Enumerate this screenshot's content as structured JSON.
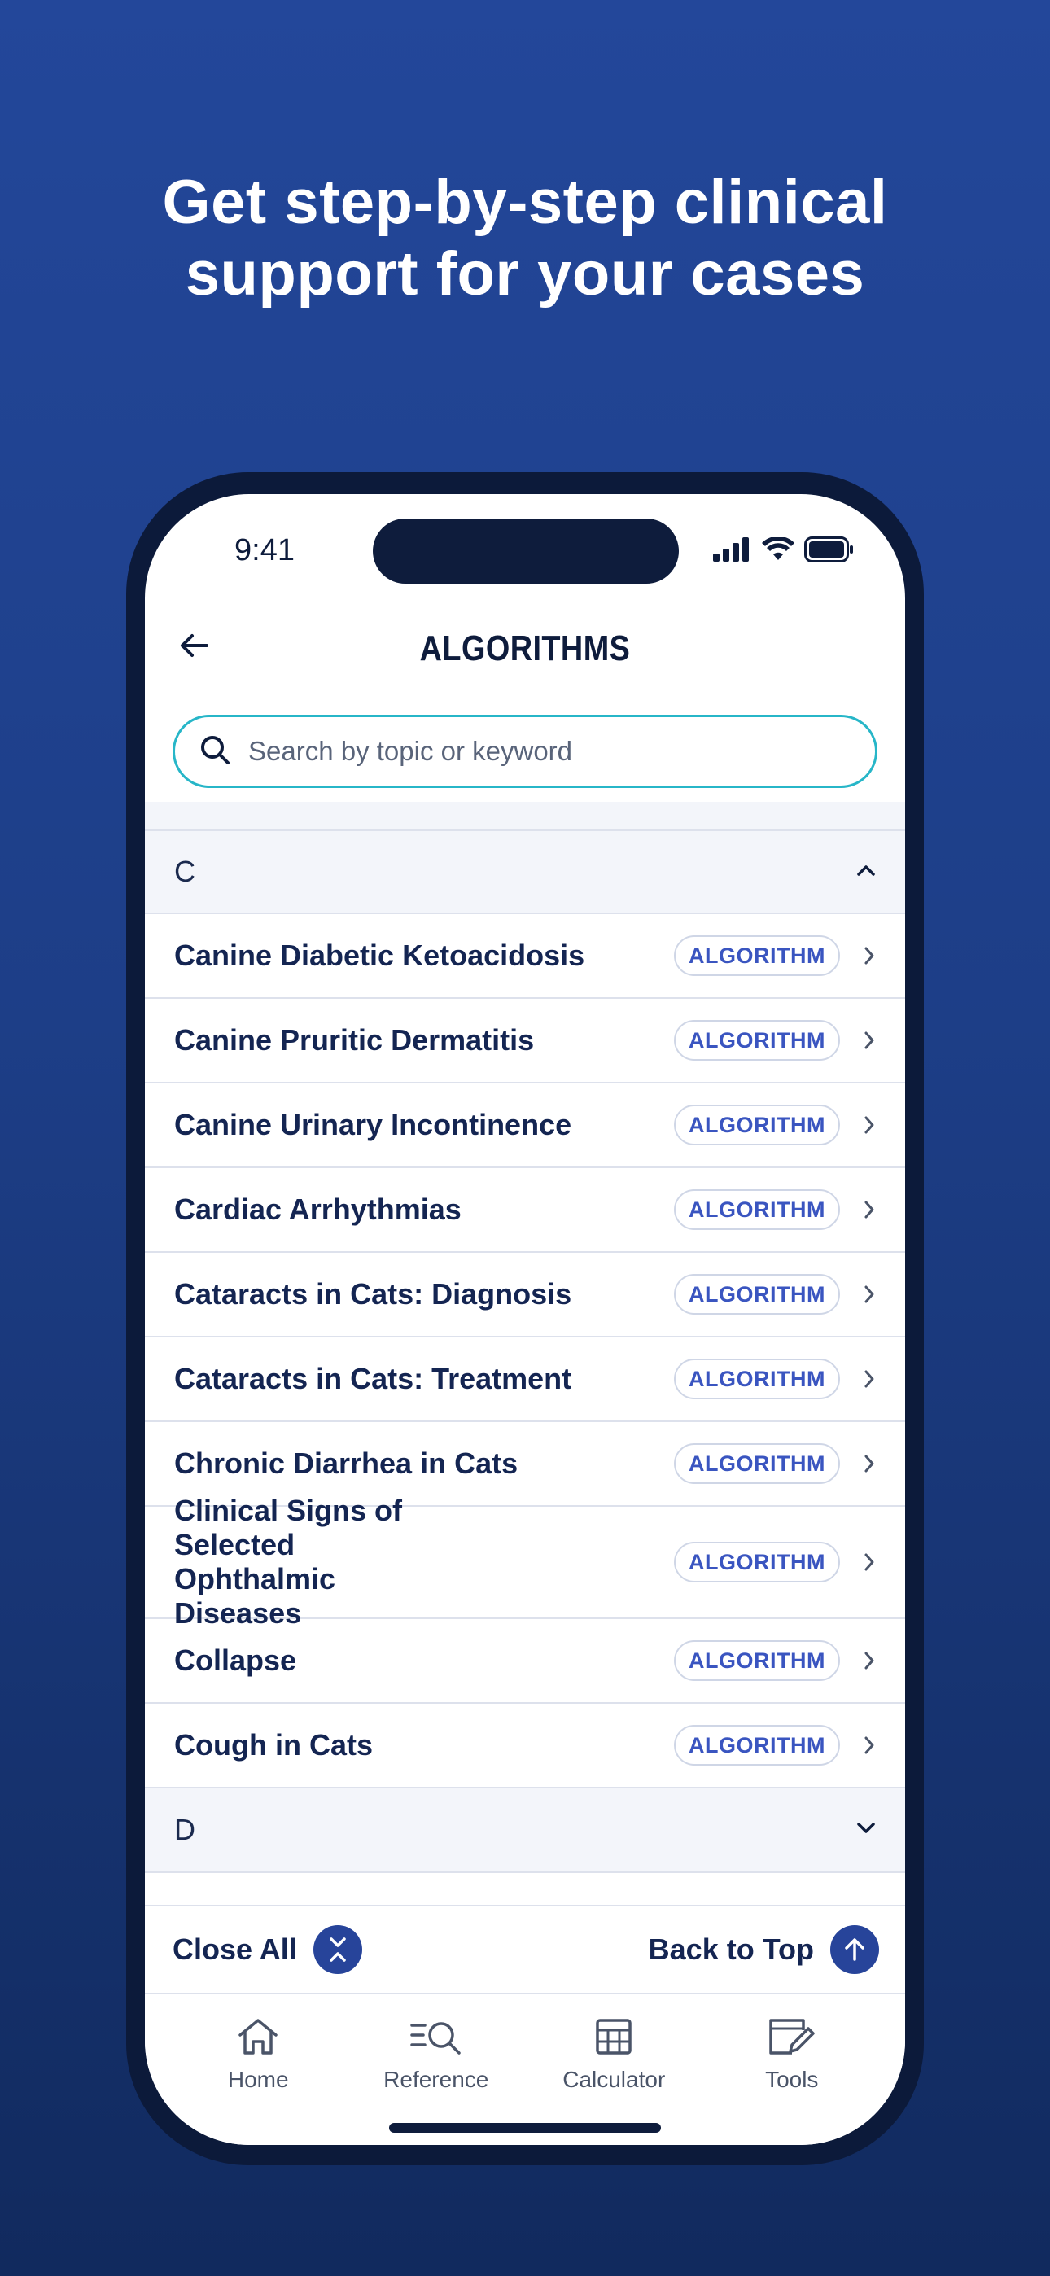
{
  "headline": {
    "line1": "Get step-by-step clinical",
    "line2": "support for your cases"
  },
  "status_bar": {
    "time": "9:41",
    "icons": [
      "signal-icon",
      "wifi-icon",
      "battery-icon"
    ]
  },
  "header": {
    "title": "ALGORITHMS",
    "back_icon": "arrow-left-icon"
  },
  "search": {
    "placeholder": "Search by topic or keyword",
    "icon": "search-icon"
  },
  "sections": [
    {
      "letter": "C",
      "expanded": true,
      "items": [
        {
          "title": "Canine Diabetic Ketoacidosis",
          "badge": "ALGORITHM"
        },
        {
          "title": "Canine Pruritic Dermatitis",
          "badge": "ALGORITHM"
        },
        {
          "title": "Canine Urinary Incontinence",
          "badge": "ALGORITHM"
        },
        {
          "title": "Cardiac Arrhythmias",
          "badge": "ALGORITHM"
        },
        {
          "title": "Cataracts in Cats: Diagnosis",
          "badge": "ALGORITHM"
        },
        {
          "title": "Cataracts in Cats: Treatment",
          "badge": "ALGORITHM"
        },
        {
          "title": "Chronic Diarrhea in Cats",
          "badge": "ALGORITHM"
        },
        {
          "title": "Clinical Signs of Selected Ophthalmic Diseases",
          "badge": "ALGORITHM"
        },
        {
          "title": "Collapse",
          "badge": "ALGORITHM"
        },
        {
          "title": "Cough in Cats",
          "badge": "ALGORITHM"
        }
      ]
    },
    {
      "letter": "D",
      "expanded": false,
      "items": []
    }
  ],
  "actions": {
    "close_all": "Close All",
    "back_to_top": "Back to Top"
  },
  "tabs": [
    {
      "label": "Home",
      "icon": "home-icon"
    },
    {
      "label": "Reference",
      "icon": "reference-search-icon"
    },
    {
      "label": "Calculator",
      "icon": "calculator-icon"
    },
    {
      "label": "Tools",
      "icon": "tools-edit-icon"
    }
  ],
  "colors": {
    "accent": "#27449a",
    "search_border": "#27b6c8",
    "badge_text": "#3a55c0",
    "text": "#142552"
  }
}
